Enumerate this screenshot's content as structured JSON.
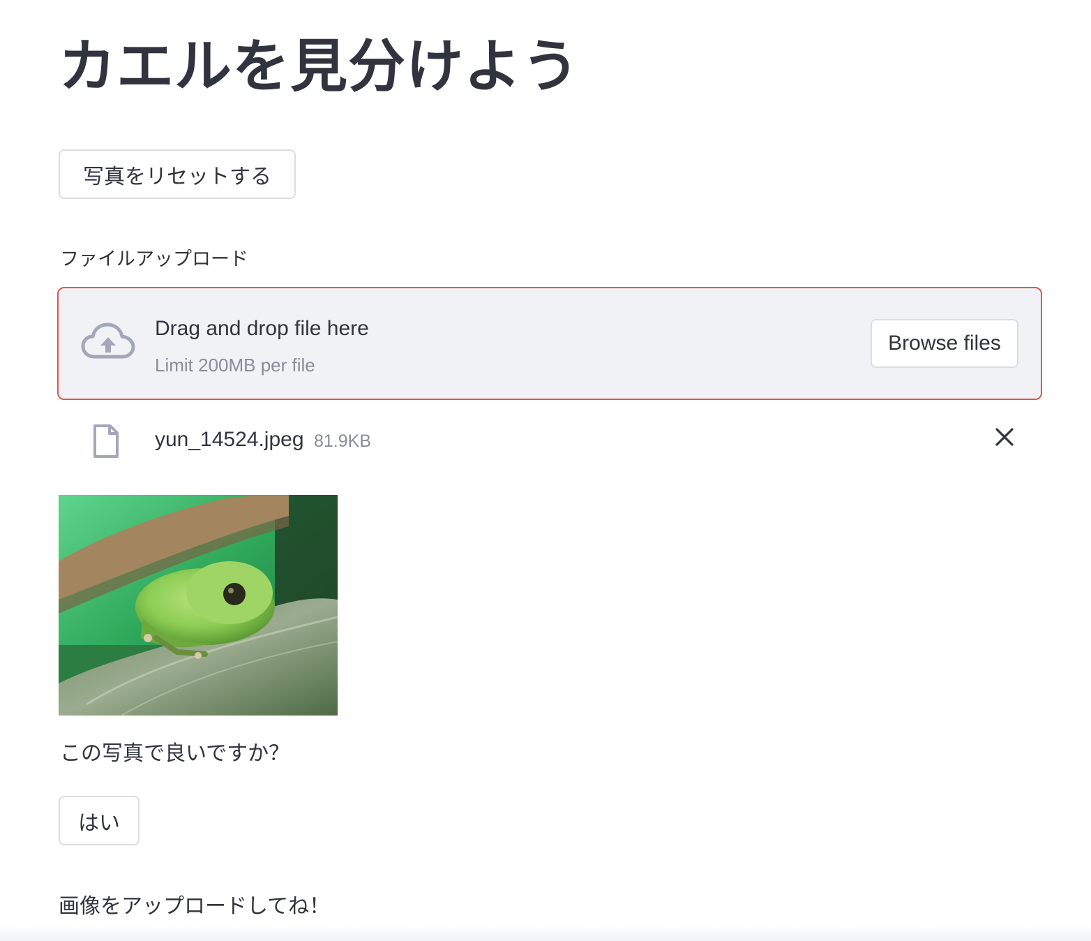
{
  "page": {
    "title": "カエルを見分けよう"
  },
  "reset_button": {
    "label": "写真をリセットする"
  },
  "uploader": {
    "label": "ファイルアップロード",
    "dropzone_title": "Drag and drop file here",
    "dropzone_limit": "Limit 200MB per file",
    "browse_label": "Browse files",
    "icon": "cloud-upload-icon",
    "border_color": "#e0574f"
  },
  "uploaded_file": {
    "name": "yun_14524.jpeg",
    "size": "81.9KB",
    "icon": "file-icon",
    "remove_icon": "close-icon"
  },
  "preview": {
    "image": "frog-photo"
  },
  "confirm": {
    "question": "この写真で良いですか？",
    "yes_label": "はい"
  },
  "instruction": "画像をアップロードしてね！"
}
